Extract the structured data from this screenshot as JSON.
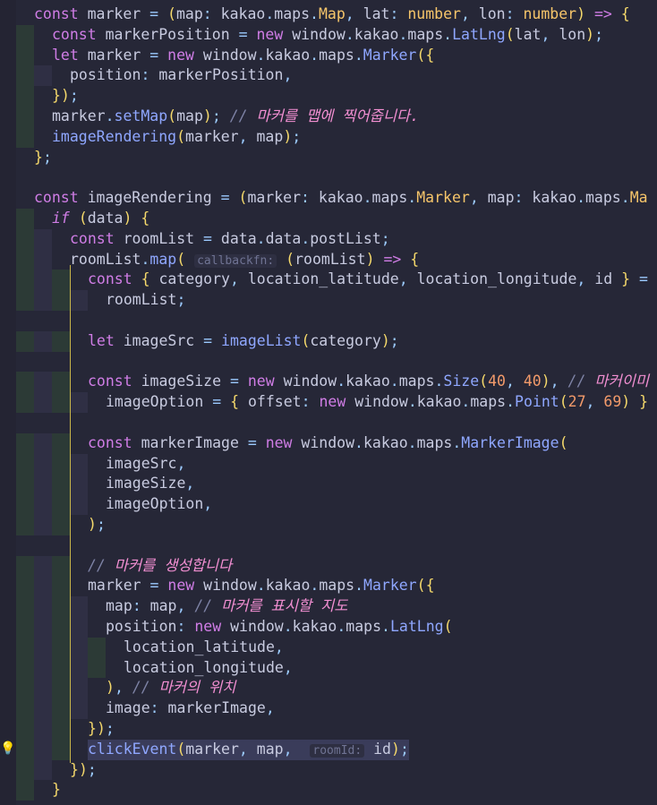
{
  "editor": {
    "theme_colors": {
      "background": "#262737",
      "keyword": "#d07de6",
      "function": "#8fa7ff",
      "type": "#f6c56a",
      "number": "#f29a6a",
      "comment": "#f28fd2"
    },
    "lines": [
      "const marker = (map: kakao.maps.Map, lat: number, lon: number) => {",
      "  const markerPosition = new window.kakao.maps.LatLng(lat, lon);",
      "  let marker = new window.kakao.maps.Marker({",
      "    position: markerPosition,",
      "  });",
      "  marker.setMap(map); // 마커를 맵에 찍어줍니다.",
      "  imageRendering(marker, map);",
      "};",
      "",
      "const imageRendering = (marker: kakao.maps.Marker, map: kakao.maps.Ma",
      "  if (data) {",
      "    const roomList = data.data.postList;",
      "    roomList.map( callbackfn: (roomList) => {",
      "      const { category, location_latitude, location_longitude, id } =",
      "        roomList;",
      "",
      "      let imageSrc = imageList(category);",
      "",
      "      const imageSize = new window.kakao.maps.Size(40, 40), // 마커이미",
      "        imageOption = { offset: new window.kakao.maps.Point(27, 69) }",
      "",
      "      const markerImage = new window.kakao.maps.MarkerImage(",
      "        imageSrc,",
      "        imageSize,",
      "        imageOption,",
      "      );",
      "",
      "      // 마커를 생성합니다",
      "      marker = new window.kakao.maps.Marker({",
      "        map: map, // 마커를 표시할 지도",
      "        position: new window.kakao.maps.LatLng(",
      "          location_latitude,",
      "          location_longitude,",
      "        ), // 마커의 위치",
      "        image: markerImage,",
      "      });",
      "      clickEvent(marker, map,  roomId: id);",
      "    });",
      "  }"
    ],
    "hints": {
      "callbackfn": "callbackfn:",
      "roomId": "roomId:"
    },
    "bulb_icon": "lightbulb-icon"
  }
}
